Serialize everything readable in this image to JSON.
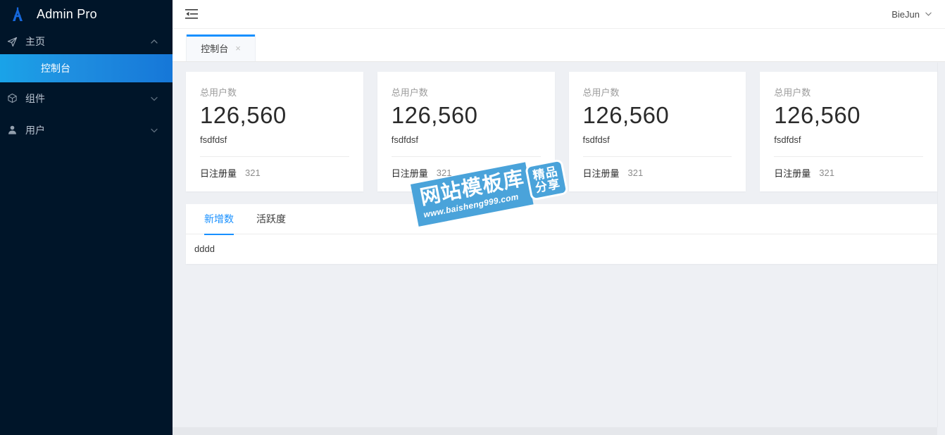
{
  "brand": {
    "title": "Admin Pro",
    "logo_icon": "letter-a-logo-icon"
  },
  "sidebar": {
    "group": {
      "label": "主页",
      "icon": "send-plane-icon",
      "chevron": "chevron-up-icon",
      "items": [
        {
          "label": "控制台",
          "active": true
        }
      ]
    },
    "items": [
      {
        "label": "组件",
        "icon": "cube-icon",
        "chevron": "chevron-down-icon"
      },
      {
        "label": "用户",
        "icon": "user-icon",
        "chevron": "chevron-down-icon"
      }
    ]
  },
  "topbar": {
    "fold_icon": "menu-fold-icon",
    "user_name": "BieJun",
    "user_chevron": "chevron-down-icon"
  },
  "tabbar": {
    "tabs": [
      {
        "label": "控制台",
        "close": "×",
        "active": true
      }
    ]
  },
  "cards": [
    {
      "label": "总用户数",
      "value": "126,560",
      "sub": "fsdfdsf",
      "footer_label": "日注册量",
      "footer_value": "321"
    },
    {
      "label": "总用户数",
      "value": "126,560",
      "sub": "fsdfdsf",
      "footer_label": "日注册量",
      "footer_value": "321"
    },
    {
      "label": "总用户数",
      "value": "126,560",
      "sub": "fsdfdsf",
      "footer_label": "日注册量",
      "footer_value": "321"
    },
    {
      "label": "总用户数",
      "value": "126,560",
      "sub": "fsdfdsf",
      "footer_label": "日注册量",
      "footer_value": "321"
    }
  ],
  "panel": {
    "tabs": [
      {
        "label": "新增数",
        "active": true
      },
      {
        "label": "活跃度",
        "active": false
      }
    ],
    "body": "dddd"
  },
  "watermark": {
    "text_cn": "网站模板库",
    "url": "www.baisheng999.com",
    "badge_line1": "精品",
    "badge_line2": "分享"
  },
  "colors": {
    "sidebar_bg": "#001529",
    "submenu_bg": "#000c17",
    "accent": "#1890ff",
    "active_gradient_start": "#1aa3e8",
    "active_gradient_end": "#1677d8",
    "content_bg": "#eef0f4",
    "watermark_blue": "#4aa3da"
  }
}
